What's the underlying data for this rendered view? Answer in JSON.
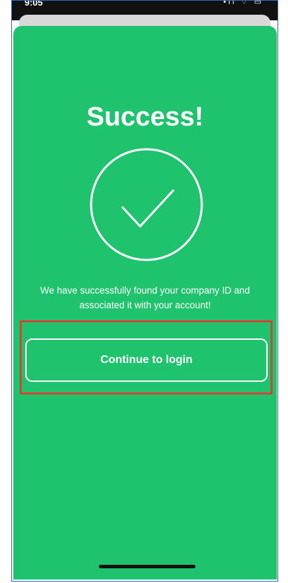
{
  "status_bar": {
    "time": "9:05",
    "icons": "•ıl ⌔ ▭"
  },
  "modal": {
    "title": "Success!",
    "icon": "checkmark-circle-icon",
    "message": "We have successfully found your company ID and associated it with your account!",
    "continue_label": "Continue to login"
  },
  "colors": {
    "modal_background": "#1fc36d",
    "text": "#ffffff",
    "highlight": "#d24438"
  }
}
